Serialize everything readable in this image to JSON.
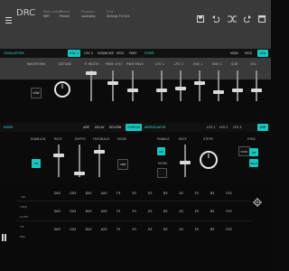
{
  "app": {
    "title": "DRC",
    "meta_cols": [
      "Meta Labels",
      "Preset",
      "Program",
      "Grid"
    ],
    "meta_vals": [
      "SMT",
      "Preset",
      "Lockstep",
      "Strings Fx Init"
    ],
    "icons": [
      "menu-icon",
      "save-icon",
      "undo-icon",
      "shuffle-icon",
      "redo-icon",
      "window-icon"
    ]
  },
  "oscillators": {
    "section_label": "OSCILLATORS",
    "tabs": [
      "OSC 1",
      "OSC 2",
      "SUB/NOISE",
      "MOD",
      "PDEF",
      "FILTER"
    ],
    "active_tab": "OSC 1",
    "right_tabs": [
      "MAIN",
      "MOD",
      "VCA"
    ],
    "right_active": "VCA",
    "params": [
      "WAVEFORM",
      "DETUNE",
      "P. WIDTH",
      "PWM LFO1",
      "PWM ENV2",
      "LFO 1",
      "LFO 2",
      "ENV 1",
      "ENV 2",
      "SUB",
      "VOL"
    ],
    "waveform_button": "SAW"
  },
  "effects": {
    "section_label": "MIXER",
    "tabs": [
      "AMP",
      "DELAY",
      "REVERB",
      "CHORUS",
      "ARPEGGIATOR"
    ],
    "active_tab": "CHORUS",
    "right_tabs": [
      "LFO 1",
      "LFO 2",
      "LFO 3",
      "AMP"
    ],
    "right_active": "AMP",
    "params_left": [
      "ENABLED",
      "RATE",
      "DEPTH",
      "FEEDBACK",
      "MODE"
    ],
    "enabled_value": "ON",
    "mode_value": "AMB",
    "params_right": [
      "ENABLE",
      "RATE",
      "STEPS",
      "SYNC"
    ],
    "arp_enabled_value": "ON",
    "arp_mode_label": "MODE",
    "arp_sync_value": "SYNC",
    "arp_side_buttons": [
      "ON",
      "HOLD"
    ]
  },
  "sequencer": {
    "row_labels": [
      "VEL",
      "FREQ",
      "GLIDE",
      "TIE",
      "ENA"
    ],
    "rows": [
      [
        "DX3",
        "GX3",
        "DX3",
        "AX3",
        "F3",
        "E3",
        "G3",
        "B3",
        "A3",
        "E3",
        "B3",
        "FX3"
      ],
      [
        "DX3",
        "GX3",
        "DX3",
        "AX3",
        "F3",
        "E3",
        "G3",
        "B3",
        "A3",
        "E3",
        "B3",
        "FX3"
      ],
      [
        "DX3",
        "GX3",
        "DX3",
        "AX3",
        "F3",
        "E3",
        "G3",
        "B3",
        "A3",
        "E3",
        "B3",
        "FX3"
      ]
    ],
    "settings_icon": "gear-icon"
  },
  "colors": {
    "accent": "#17c7bf",
    "panel": "#0b0b0b",
    "topbar": "#3a3a3a"
  }
}
